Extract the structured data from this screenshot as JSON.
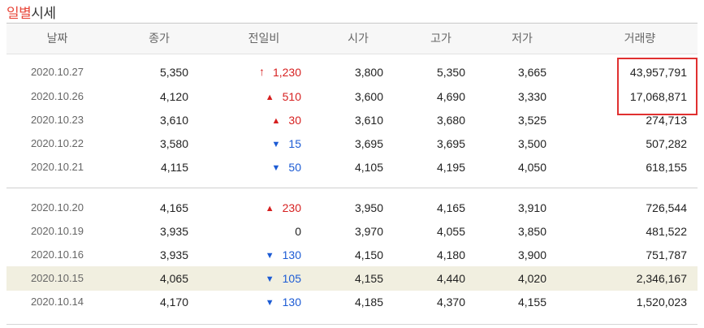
{
  "title": {
    "highlight": "일별",
    "rest": "시세"
  },
  "columns": [
    "날짜",
    "종가",
    "전일비",
    "시가",
    "고가",
    "저가",
    "거래량"
  ],
  "rows": [
    {
      "date": "2020.10.27",
      "close": "5,350",
      "change": "1,230",
      "dir": "upper",
      "open": "3,800",
      "high": "5,350",
      "low": "3,665",
      "volume": "43,957,791"
    },
    {
      "date": "2020.10.26",
      "close": "4,120",
      "change": "510",
      "dir": "up",
      "open": "3,600",
      "high": "4,690",
      "low": "3,330",
      "volume": "17,068,871"
    },
    {
      "date": "2020.10.23",
      "close": "3,610",
      "change": "30",
      "dir": "up",
      "open": "3,610",
      "high": "3,680",
      "low": "3,525",
      "volume": "274,713"
    },
    {
      "date": "2020.10.22",
      "close": "3,580",
      "change": "15",
      "dir": "down",
      "open": "3,695",
      "high": "3,695",
      "low": "3,500",
      "volume": "507,282"
    },
    {
      "date": "2020.10.21",
      "close": "4,115",
      "change": "50",
      "dir": "down",
      "open": "4,105",
      "high": "4,195",
      "low": "4,050",
      "volume": "618,155"
    },
    {
      "date": "2020.10.20",
      "close": "4,165",
      "change": "230",
      "dir": "up",
      "open": "3,950",
      "high": "4,165",
      "low": "3,910",
      "volume": "726,544"
    },
    {
      "date": "2020.10.19",
      "close": "3,935",
      "change": "0",
      "dir": "flat",
      "open": "3,970",
      "high": "4,055",
      "low": "3,850",
      "volume": "481,522"
    },
    {
      "date": "2020.10.16",
      "close": "3,935",
      "change": "130",
      "dir": "down",
      "open": "4,150",
      "high": "4,180",
      "low": "3,900",
      "volume": "751,787"
    },
    {
      "date": "2020.10.15",
      "close": "4,065",
      "change": "105",
      "dir": "down",
      "open": "4,155",
      "high": "4,440",
      "low": "4,020",
      "volume": "2,346,167"
    },
    {
      "date": "2020.10.14",
      "close": "4,170",
      "change": "130",
      "dir": "down",
      "open": "4,185",
      "high": "4,370",
      "low": "4,155",
      "volume": "1,520,023"
    }
  ],
  "highlighted_row_index": 8,
  "annotated_rows": [
    0,
    1
  ],
  "colors": {
    "up": "#d61f1f",
    "down": "#1c5bd4",
    "title_accent": "#e8473a",
    "highlight_bg": "#f1efe0",
    "annotation_box": "#e03030"
  }
}
